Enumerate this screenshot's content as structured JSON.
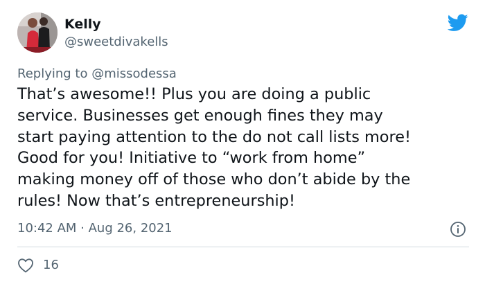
{
  "author": {
    "display_name": "Kelly",
    "handle": "@sweetdivakells",
    "avatar_icon": "profile-photo"
  },
  "brand": {
    "icon": "twitter-bird-icon",
    "color": "#1d9bf0"
  },
  "reply": {
    "prefix": "Replying to",
    "mention": "@missodessa"
  },
  "tweet": {
    "lines": [
      "That’s awesome!! Plus you are doing a public",
      "service.  Businesses get enough fines they may",
      "start paying attention to the do not call lists more!",
      "Good for you!  Initiative to “work from home”",
      "making money off of those who don’t abide by the",
      "rules!  Now that’s entrepreneurship!"
    ],
    "timestamp": "10:42 AM · Aug 26, 2021"
  },
  "engagement": {
    "like_icon": "heart-icon",
    "like_count": "16",
    "info_icon": "info-icon"
  },
  "colors": {
    "text_primary": "#0f1419",
    "text_secondary": "#536471",
    "divider": "#cfd9de"
  }
}
